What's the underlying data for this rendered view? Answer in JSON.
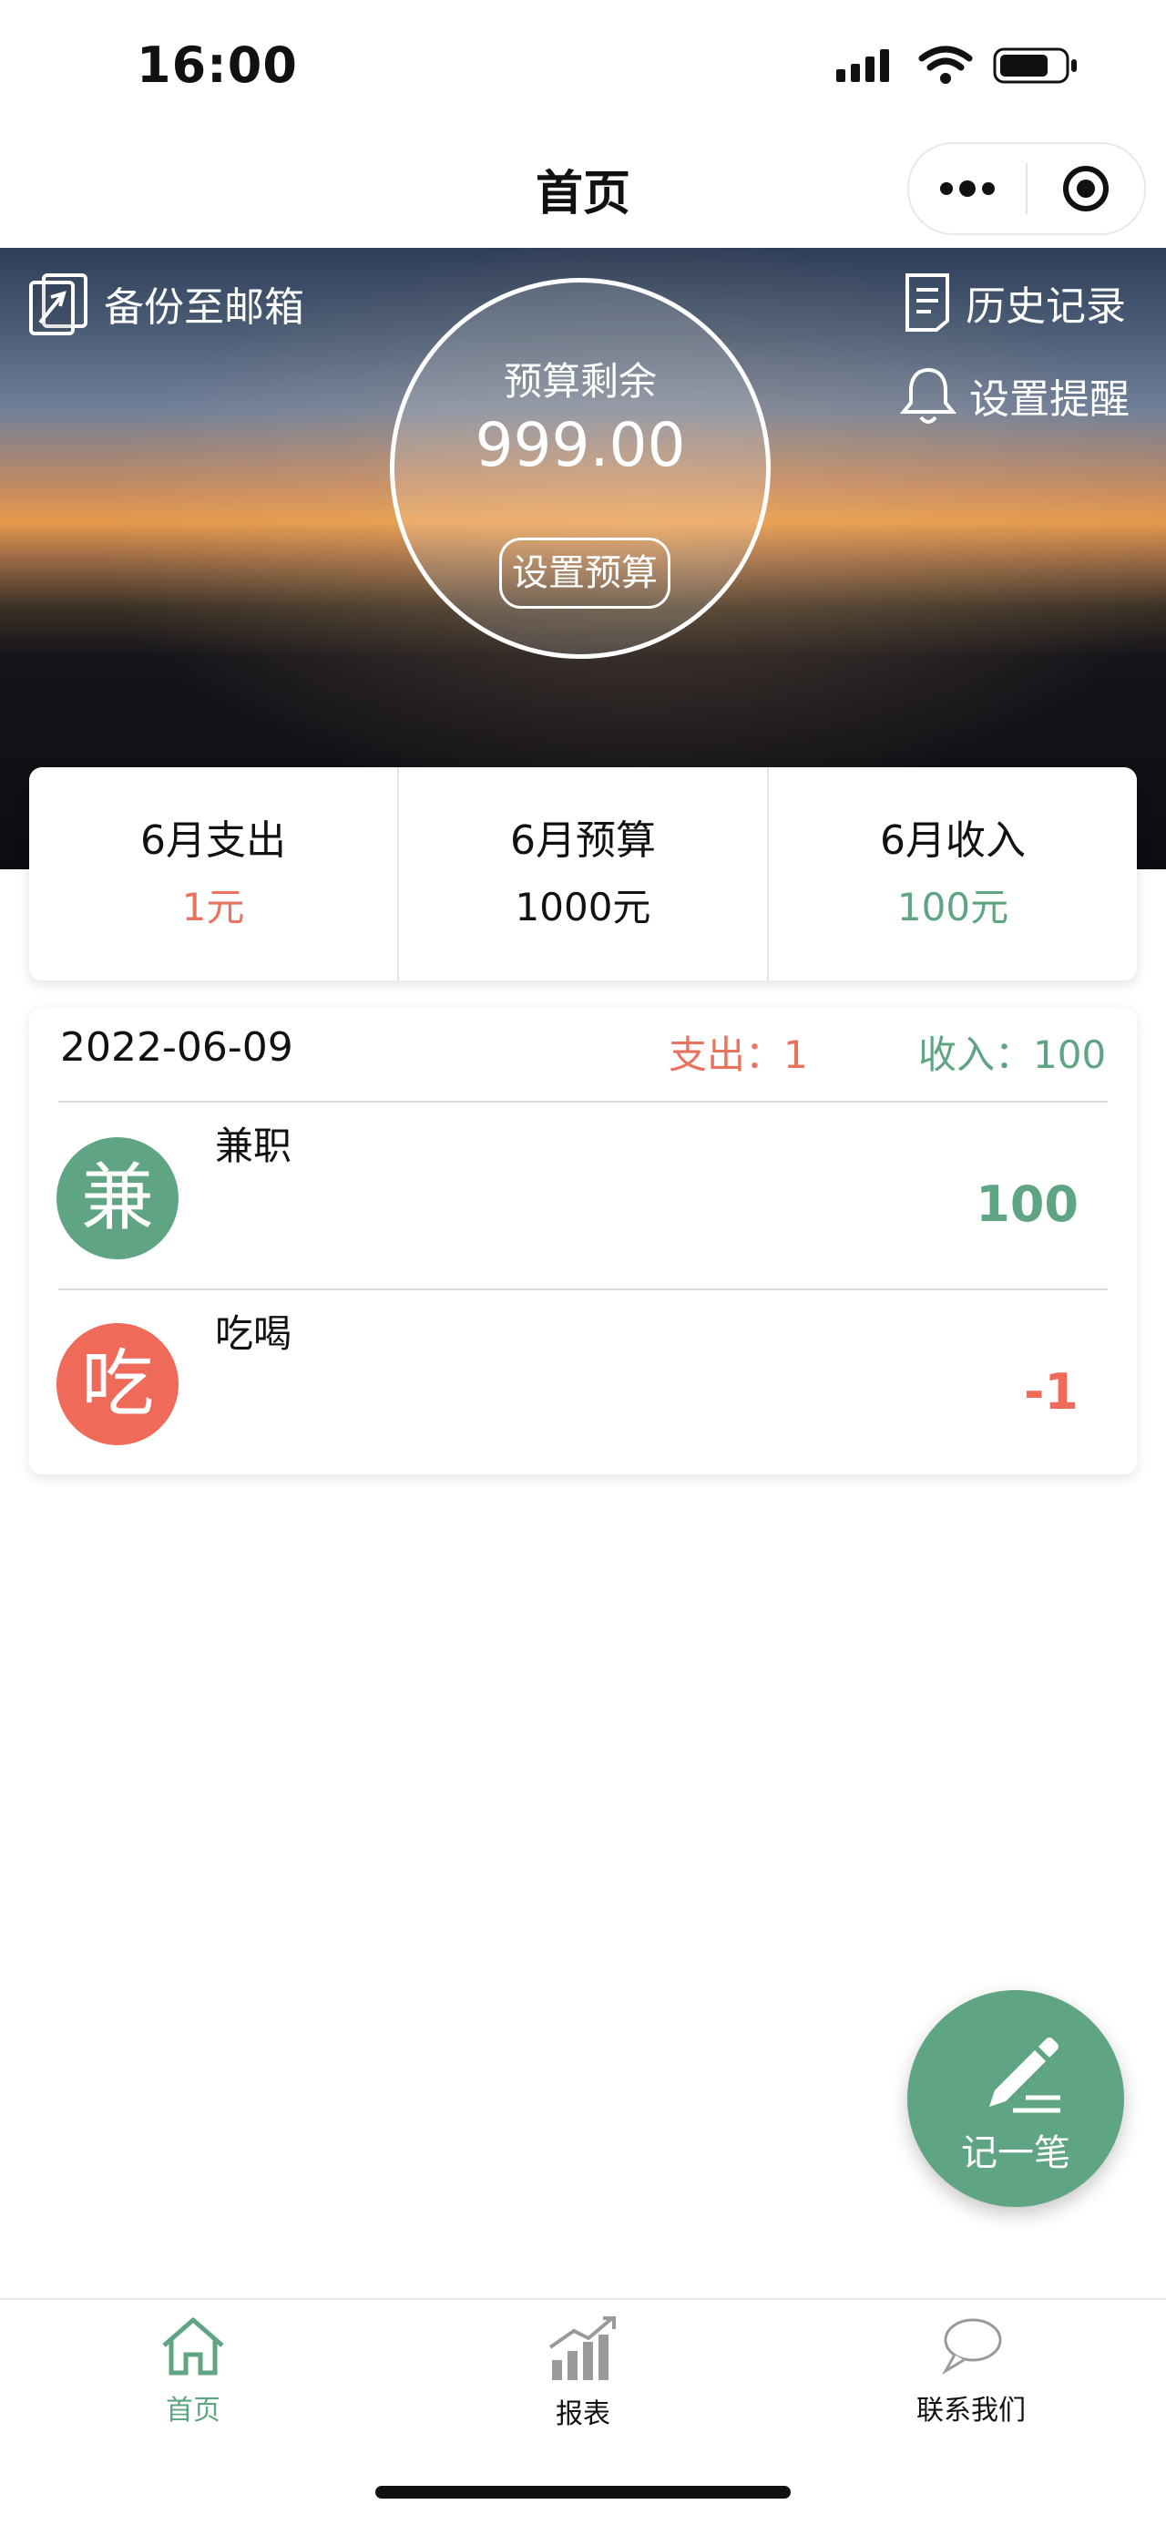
{
  "status": {
    "time": "16:00"
  },
  "nav": {
    "title": "首页"
  },
  "hero": {
    "backup_label": "备份至邮箱",
    "history_label": "历史记录",
    "reminder_label": "设置提醒",
    "budget_remaining_label": "预算剩余",
    "budget_remaining_value": "999.00",
    "set_budget_label": "设置预算"
  },
  "stats": [
    {
      "label": "6月支出",
      "value": "1元",
      "color": "#e8735e"
    },
    {
      "label": "6月预算",
      "value": "1000元",
      "color": "#111111"
    },
    {
      "label": "6月收入",
      "value": "100元",
      "color": "#5fa583"
    }
  ],
  "records": {
    "date": "2022-06-09",
    "expense_summary": "支出：1",
    "income_summary": "收入：100",
    "items": [
      {
        "icon_char": "兼",
        "name": "兼职",
        "amount": "100",
        "color": "#5fa583"
      },
      {
        "icon_char": "吃",
        "name": "吃喝",
        "amount": "-1",
        "color": "#f06a5a"
      }
    ]
  },
  "fab": {
    "label": "记一笔"
  },
  "tabs": [
    {
      "label": "首页",
      "icon": "home-icon",
      "active": true
    },
    {
      "label": "报表",
      "icon": "chart-icon",
      "active": false
    },
    {
      "label": "联系我们",
      "icon": "chat-bubble-icon",
      "active": false
    }
  ],
  "colors": {
    "accent": "#5fa583",
    "expense": "#e8735e"
  }
}
